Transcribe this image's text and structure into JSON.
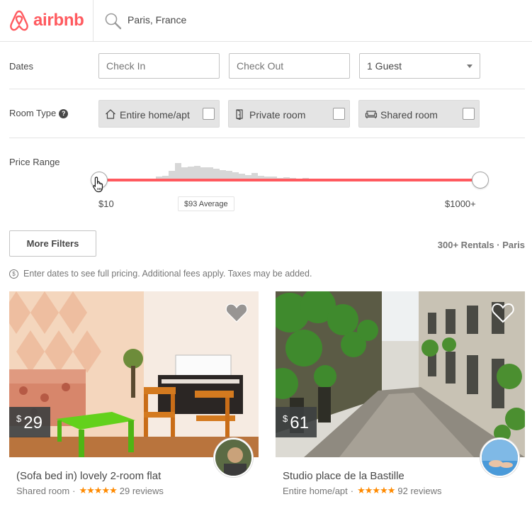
{
  "header": {
    "brand": "airbnb",
    "brand_color": "#ff5a5f",
    "search_value": "Paris, France"
  },
  "filters": {
    "dates_label": "Dates",
    "check_in_placeholder": "Check In",
    "check_out_placeholder": "Check Out",
    "guests_value": "1 Guest",
    "room_type_label": "Room Type",
    "help_glyph": "?",
    "room_types": [
      {
        "label": "Entire home/apt",
        "icon": "house-icon"
      },
      {
        "label": "Private room",
        "icon": "door-icon"
      },
      {
        "label": "Shared room",
        "icon": "sofa-icon"
      }
    ],
    "price_range_label": "Price Range",
    "price_min": "$10",
    "price_max": "$1000+",
    "price_average": "$93 Average",
    "more_filters_label": "More Filters",
    "rentals_count": "300+ Rentals · Paris",
    "notice": "Enter dates to see full pricing. Additional fees apply. Taxes may be added.",
    "notice_icon": "$"
  },
  "listings": [
    {
      "currency": "$",
      "price": "29",
      "title": "(Sofa bed in) lovely 2-room flat",
      "room_type": "Shared room",
      "rating": 4.5,
      "rating_stars": "★★★★★",
      "reviews": "29 reviews",
      "separator": "·",
      "saved": true
    },
    {
      "currency": "$",
      "price": "61",
      "title": "Studio place de la Bastille",
      "room_type": "Entire home/apt",
      "rating": 4.5,
      "rating_stars": "★★★★★",
      "reviews": "92 reviews",
      "separator": "·",
      "saved": false
    }
  ]
}
